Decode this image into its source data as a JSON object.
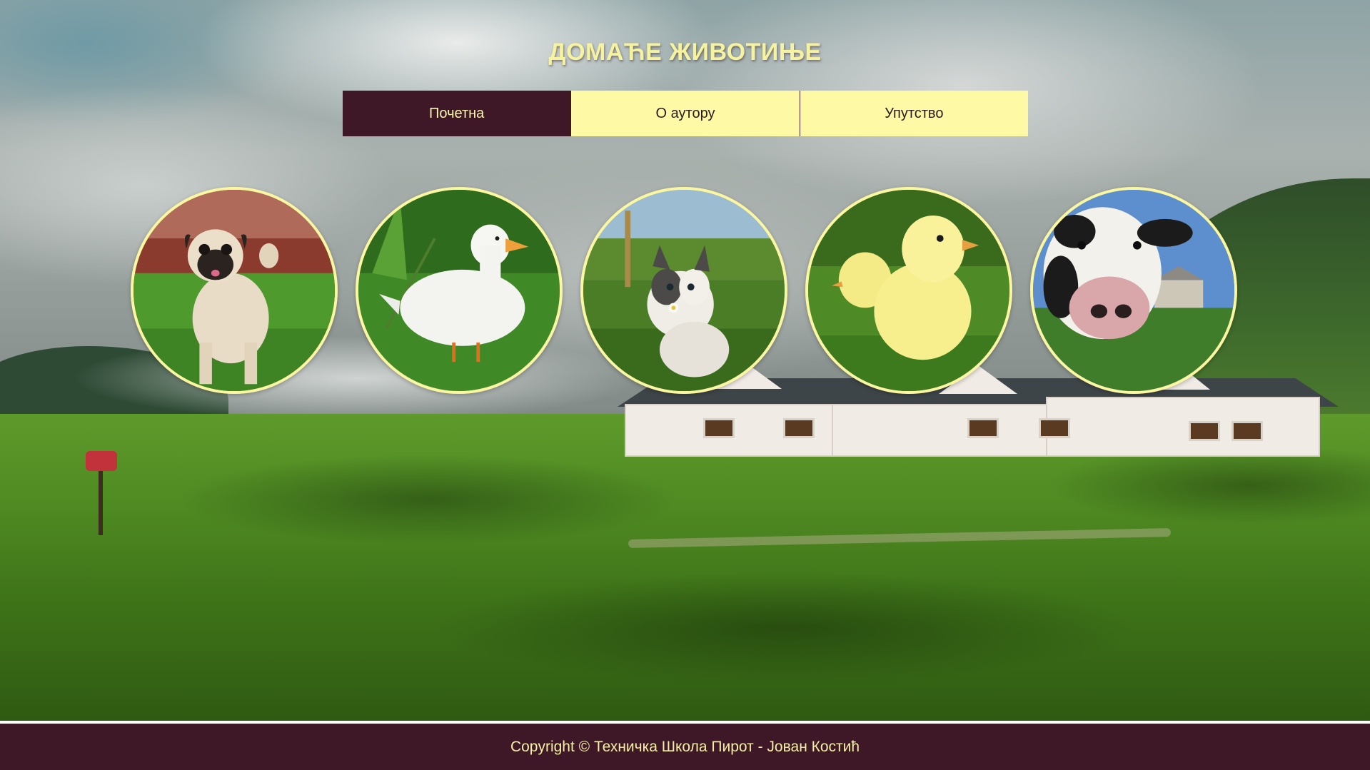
{
  "header": {
    "title": "ДОМАЋЕ ЖИВОТИЊЕ"
  },
  "nav": {
    "items": [
      {
        "label": "Почетна",
        "active": true
      },
      {
        "label": "О аутору",
        "active": false
      },
      {
        "label": "Упутство",
        "active": false
      }
    ]
  },
  "gallery": {
    "animals": [
      "pug-dog-photo",
      "white-duck-photo",
      "kitten-photo",
      "yellow-chicks-photo",
      "cow-photo"
    ]
  },
  "footer": {
    "copyright": "Copyright © Техничка Школа Пирот - Јован Костић"
  },
  "colors": {
    "accent_dark": "#3e1826",
    "accent_light": "#fdf9a4",
    "title": "#f5f2a0"
  }
}
